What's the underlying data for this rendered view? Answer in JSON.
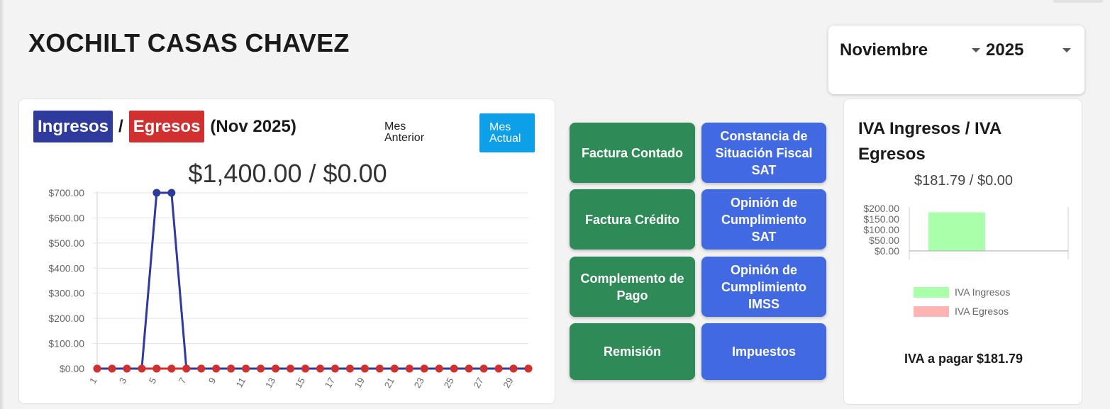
{
  "title": "XOCHILT CASAS CHAVEZ",
  "period_select": {
    "month": "Noviembre",
    "year": "2025"
  },
  "income_card": {
    "ingresos_label": "Ingresos",
    "slash": "/",
    "egresos_label": "Egresos",
    "period": "(Nov 2025)",
    "prev_month_label": "Mes Anterior",
    "current_month_label": "Mes Actual",
    "totals": "$1,400.00 / $0.00"
  },
  "actions": [
    {
      "label": "Factura Contado",
      "color": "#2e8b57"
    },
    {
      "label": "Constancia de Situación Fiscal SAT",
      "color": "#4169e1"
    },
    {
      "label": "Factura Crédito",
      "color": "#2e8b57"
    },
    {
      "label": "Opinión de Cumplimiento SAT",
      "color": "#4169e1"
    },
    {
      "label": "Complemento de Pago",
      "color": "#2e8b57"
    },
    {
      "label": "Opinión de Cumplimiento IMSS",
      "color": "#4169e1"
    },
    {
      "label": "Remisión",
      "color": "#2e8b57"
    },
    {
      "label": "Impuestos",
      "color": "#4169e1"
    }
  ],
  "iva_card": {
    "title": "IVA Ingresos / IVA Egresos",
    "totals": "$181.79 / $0.00",
    "to_pay": "IVA a pagar $181.79"
  },
  "chart_data": [
    {
      "type": "line",
      "x": [
        1,
        2,
        3,
        4,
        5,
        6,
        7,
        8,
        9,
        10,
        11,
        12,
        13,
        14,
        15,
        16,
        17,
        18,
        19,
        20,
        21,
        22,
        23,
        24,
        25,
        26,
        27,
        28,
        29,
        30
      ],
      "xticks": [
        "1",
        "3",
        "5",
        "7",
        "9",
        "11",
        "13",
        "15",
        "17",
        "19",
        "21",
        "23",
        "25",
        "27",
        "29"
      ],
      "yticks": [
        "$0.00",
        "$100.00",
        "$200.00",
        "$300.00",
        "$400.00",
        "$500.00",
        "$600.00",
        "$700.00"
      ],
      "ylim": [
        0,
        700
      ],
      "grid": true,
      "series": [
        {
          "color": "#2e3b9d",
          "values": [
            0,
            0,
            0,
            0,
            700,
            700,
            0,
            0,
            0,
            0,
            0,
            0,
            0,
            0,
            0,
            0,
            0,
            0,
            0,
            0,
            0,
            0,
            0,
            0,
            0,
            0,
            0,
            0,
            0,
            0
          ]
        },
        {
          "color": "#d0302f",
          "values": [
            0,
            0,
            0,
            0,
            0,
            0,
            0,
            0,
            0,
            0,
            0,
            0,
            0,
            0,
            0,
            0,
            0,
            0,
            0,
            0,
            0,
            0,
            0,
            0,
            0,
            0,
            0,
            0,
            0,
            0
          ]
        }
      ]
    },
    {
      "type": "bar",
      "categories": [
        ""
      ],
      "yticks": [
        "$0.00",
        "$50.00",
        "$100.00",
        "$150.00",
        "$200.00"
      ],
      "ylim": [
        0,
        200
      ],
      "series": [
        {
          "name": "IVA Ingresos",
          "color": "#aaffaa",
          "values": [
            181.79
          ]
        },
        {
          "name": "IVA Egresos",
          "color": "#ffb3b3",
          "values": [
            0
          ]
        }
      ]
    }
  ]
}
